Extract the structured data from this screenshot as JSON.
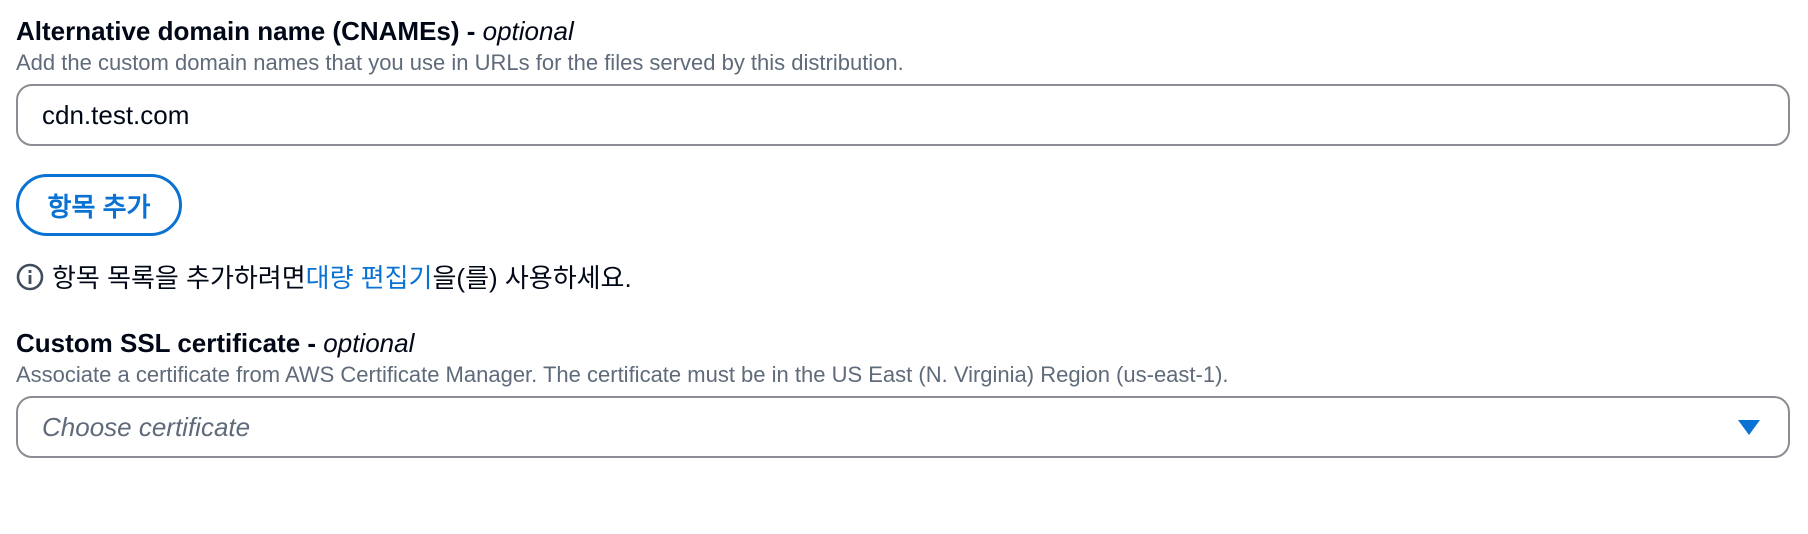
{
  "cname": {
    "label": "Alternative domain name (CNAMEs)",
    "label_suffix": " - ",
    "optional": "optional",
    "description": "Add the custom domain names that you use in URLs for the files served by this distribution.",
    "value": "cdn.test.com",
    "add_button": "항목 추가",
    "info_prefix": "항목 목록을 추가하려면 ",
    "info_link": "대량 편집기",
    "info_suffix": "을(를) 사용하세요."
  },
  "ssl": {
    "label": "Custom SSL certificate",
    "label_suffix": " - ",
    "optional": "optional",
    "description": "Associate a certificate from AWS Certificate Manager. The certificate must be in the US East (N. Virginia) Region (us-east-1).",
    "placeholder": "Choose certificate"
  },
  "colors": {
    "accent": "#0972d3",
    "text": "#000716",
    "secondary_text": "#5f6b7a",
    "border": "#8c8c94"
  },
  "icons": {
    "info": "info-circle-icon",
    "dropdown": "caret-down-icon"
  }
}
